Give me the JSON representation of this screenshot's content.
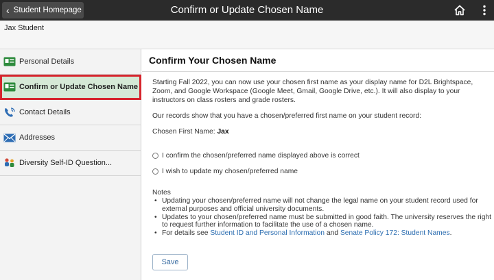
{
  "header": {
    "back_label": "Student Homepage",
    "title": "Confirm or Update Chosen Name",
    "home_icon": "home-icon",
    "menu_icon": "more-vertical-icon",
    "background": "#2b2b2b"
  },
  "student": {
    "name": "Jax Student"
  },
  "sidebar": {
    "items": [
      {
        "label": "Personal Details",
        "icon": "id-card-icon",
        "active": false
      },
      {
        "label": "Confirm or Update Chosen Name",
        "icon": "id-card-icon",
        "active": true
      },
      {
        "label": "Contact Details",
        "icon": "phone-icon",
        "active": false
      },
      {
        "label": "Addresses",
        "icon": "envelope-icon",
        "active": false
      },
      {
        "label": "Diversity Self-ID Question...",
        "icon": "people-icon",
        "active": false
      }
    ],
    "active_highlight": "#d5e9d6",
    "active_border": "#d6242c"
  },
  "main": {
    "title": "Confirm Your Chosen Name",
    "intro": "Starting Fall 2022, you can now use your chosen first name as your display name for D2L Brightspace, Zoom, and Google Workspace (Google Meet, Gmail, Google Drive, etc.). It will also display to your instructors on class rosters and grade rosters.",
    "records_text": "Our records show that you have a chosen/preferred first name on your student record:",
    "chosen_label": "Chosen First Name:",
    "chosen_value": "Jax",
    "options": [
      "I confirm the chosen/preferred name displayed above is correct",
      "I wish to update my chosen/preferred name"
    ],
    "notes_title": "Notes",
    "notes": [
      "Updating your chosen/preferred name will not change the legal name on your student record used for external purposes and official university documents.",
      "Updates to your chosen/preferred name must be submitted in good faith. The university reserves the right to request further information to facilitate the use of a chosen name."
    ],
    "details_prefix": "For details see",
    "link1": "Student ID and Personal Information",
    "details_and": "and",
    "link2": "Senate Policy 172: Student Names",
    "details_suffix": ".",
    "save_label": "Save"
  }
}
